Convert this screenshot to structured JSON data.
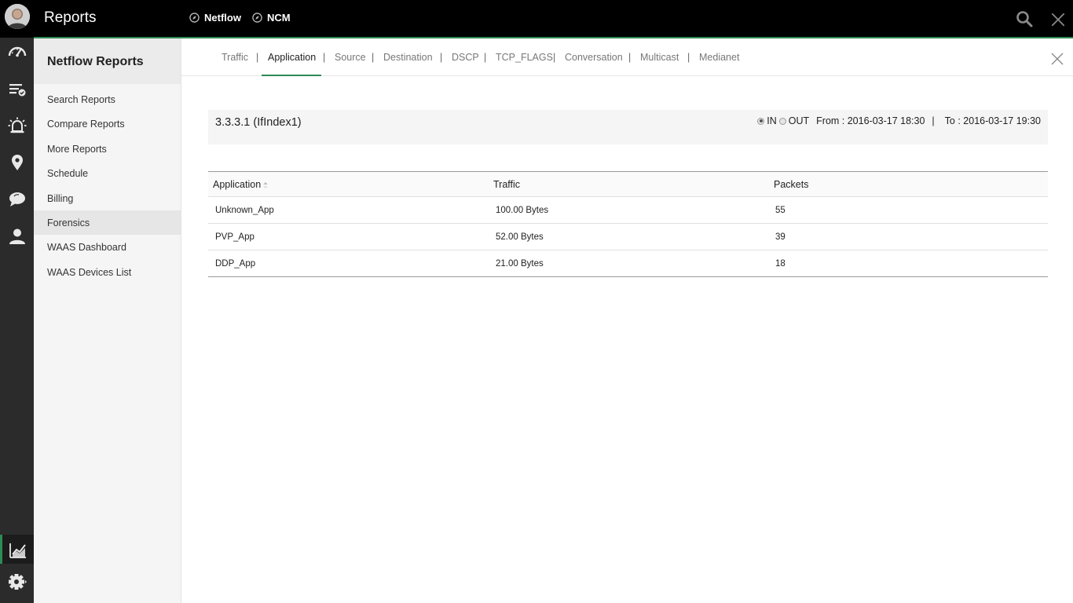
{
  "header": {
    "title": "Reports",
    "modules": [
      {
        "label": "Netflow"
      },
      {
        "label": "NCM"
      }
    ]
  },
  "sidebar": {
    "title": "Netflow Reports",
    "items": [
      {
        "label": "Search Reports"
      },
      {
        "label": "Compare Reports"
      },
      {
        "label": "More Reports"
      },
      {
        "label": "Schedule"
      },
      {
        "label": "Billing"
      },
      {
        "label": "Forensics",
        "active": true
      },
      {
        "label": "WAAS Dashboard"
      },
      {
        "label": "WAAS Devices List"
      }
    ]
  },
  "tabs": [
    {
      "label": "Traffic"
    },
    {
      "label": "Application",
      "active": true
    },
    {
      "label": "Source"
    },
    {
      "label": "Destination"
    },
    {
      "label": "DSCP"
    },
    {
      "label": "TCP_FLAGS"
    },
    {
      "label": "Conversation"
    },
    {
      "label": "Multicast"
    },
    {
      "label": "Medianet"
    }
  ],
  "tab_separator": "|",
  "report": {
    "title": "3.3.3.1 (IfIndex1)",
    "direction_in": "IN",
    "direction_out": "OUT",
    "selected_direction": "IN",
    "from": "From : 2016-03-17 18:30",
    "separator": "|",
    "to": "To : 2016-03-17 19:30"
  },
  "table": {
    "columns": [
      "Application",
      "Traffic",
      "Packets"
    ],
    "rows": [
      [
        "Unknown_App",
        "100.00 Bytes",
        "55"
      ],
      [
        "PVP_App",
        "52.00 Bytes",
        "39"
      ],
      [
        "DDP_App",
        "21.00 Bytes",
        "18"
      ]
    ]
  },
  "icons": {
    "rail": [
      "dashboard-icon",
      "inventory-icon",
      "alarm-icon",
      "map-icon",
      "chat-icon",
      "user-icon",
      "reports-icon",
      "settings-icon"
    ],
    "top": [
      "search-icon",
      "close-icon"
    ]
  },
  "colors": {
    "accent": "#2e8b57",
    "topbar": "#000000",
    "rail": "#2b2b2b"
  }
}
